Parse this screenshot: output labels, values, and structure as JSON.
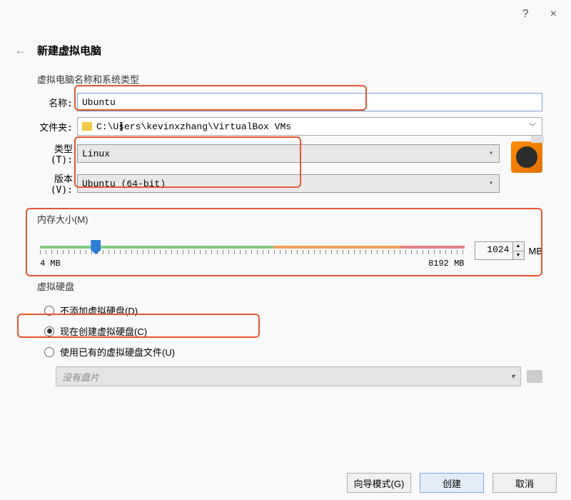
{
  "titlebar": {
    "help": "?",
    "close": "×"
  },
  "header": {
    "title": "新建虚拟电脑"
  },
  "sections": {
    "name_os": {
      "title": "虚拟电脑名称和系统类型",
      "name_label": "名称:",
      "name_value": "Ubuntu",
      "folder_label": "文件夹:",
      "folder_value": "C:\\Users\\kevinxzhang\\VirtualBox VMs",
      "type_label": "类型(T):",
      "type_value": "Linux",
      "version_label": "版本(V):",
      "version_value": "Ubuntu (64-bit)"
    },
    "memory": {
      "title": "内存大小(M)",
      "min_label": "4 MB",
      "max_label": "8192 MB",
      "value": "1024",
      "unit": "MB"
    },
    "disk": {
      "title": "虚拟硬盘",
      "opt_none": "不添加虚拟硬盘(D)",
      "opt_create": "现在创建虚拟硬盘(C)",
      "opt_existing": "使用已有的虚拟硬盘文件(U)",
      "file_placeholder": "没有盘片"
    }
  },
  "footer": {
    "guided": "向导模式(G)",
    "create": "创建",
    "cancel": "取消"
  }
}
